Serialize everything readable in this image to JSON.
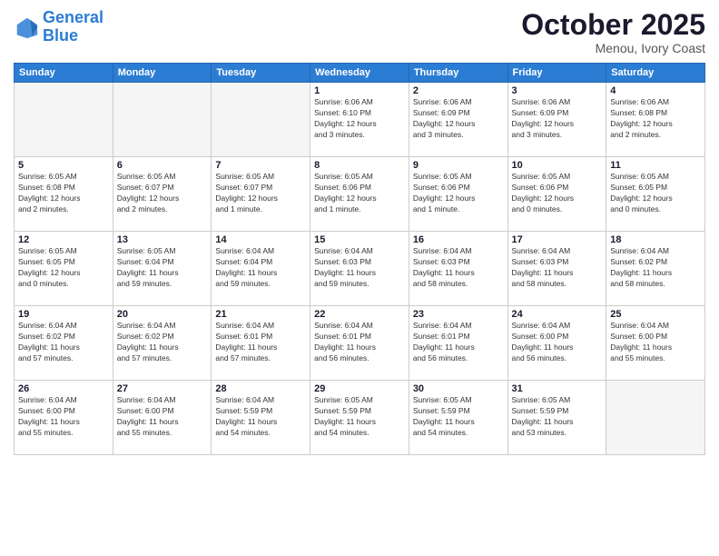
{
  "logo": {
    "line1": "General",
    "line2": "Blue"
  },
  "header": {
    "month": "October 2025",
    "location": "Menou, Ivory Coast"
  },
  "weekdays": [
    "Sunday",
    "Monday",
    "Tuesday",
    "Wednesday",
    "Thursday",
    "Friday",
    "Saturday"
  ],
  "weeks": [
    [
      {
        "day": "",
        "info": ""
      },
      {
        "day": "",
        "info": ""
      },
      {
        "day": "",
        "info": ""
      },
      {
        "day": "1",
        "info": "Sunrise: 6:06 AM\nSunset: 6:10 PM\nDaylight: 12 hours\nand 3 minutes."
      },
      {
        "day": "2",
        "info": "Sunrise: 6:06 AM\nSunset: 6:09 PM\nDaylight: 12 hours\nand 3 minutes."
      },
      {
        "day": "3",
        "info": "Sunrise: 6:06 AM\nSunset: 6:09 PM\nDaylight: 12 hours\nand 3 minutes."
      },
      {
        "day": "4",
        "info": "Sunrise: 6:06 AM\nSunset: 6:08 PM\nDaylight: 12 hours\nand 2 minutes."
      }
    ],
    [
      {
        "day": "5",
        "info": "Sunrise: 6:05 AM\nSunset: 6:08 PM\nDaylight: 12 hours\nand 2 minutes."
      },
      {
        "day": "6",
        "info": "Sunrise: 6:05 AM\nSunset: 6:07 PM\nDaylight: 12 hours\nand 2 minutes."
      },
      {
        "day": "7",
        "info": "Sunrise: 6:05 AM\nSunset: 6:07 PM\nDaylight: 12 hours\nand 1 minute."
      },
      {
        "day": "8",
        "info": "Sunrise: 6:05 AM\nSunset: 6:06 PM\nDaylight: 12 hours\nand 1 minute."
      },
      {
        "day": "9",
        "info": "Sunrise: 6:05 AM\nSunset: 6:06 PM\nDaylight: 12 hours\nand 1 minute."
      },
      {
        "day": "10",
        "info": "Sunrise: 6:05 AM\nSunset: 6:06 PM\nDaylight: 12 hours\nand 0 minutes."
      },
      {
        "day": "11",
        "info": "Sunrise: 6:05 AM\nSunset: 6:05 PM\nDaylight: 12 hours\nand 0 minutes."
      }
    ],
    [
      {
        "day": "12",
        "info": "Sunrise: 6:05 AM\nSunset: 6:05 PM\nDaylight: 12 hours\nand 0 minutes."
      },
      {
        "day": "13",
        "info": "Sunrise: 6:05 AM\nSunset: 6:04 PM\nDaylight: 11 hours\nand 59 minutes."
      },
      {
        "day": "14",
        "info": "Sunrise: 6:04 AM\nSunset: 6:04 PM\nDaylight: 11 hours\nand 59 minutes."
      },
      {
        "day": "15",
        "info": "Sunrise: 6:04 AM\nSunset: 6:03 PM\nDaylight: 11 hours\nand 59 minutes."
      },
      {
        "day": "16",
        "info": "Sunrise: 6:04 AM\nSunset: 6:03 PM\nDaylight: 11 hours\nand 58 minutes."
      },
      {
        "day": "17",
        "info": "Sunrise: 6:04 AM\nSunset: 6:03 PM\nDaylight: 11 hours\nand 58 minutes."
      },
      {
        "day": "18",
        "info": "Sunrise: 6:04 AM\nSunset: 6:02 PM\nDaylight: 11 hours\nand 58 minutes."
      }
    ],
    [
      {
        "day": "19",
        "info": "Sunrise: 6:04 AM\nSunset: 6:02 PM\nDaylight: 11 hours\nand 57 minutes."
      },
      {
        "day": "20",
        "info": "Sunrise: 6:04 AM\nSunset: 6:02 PM\nDaylight: 11 hours\nand 57 minutes."
      },
      {
        "day": "21",
        "info": "Sunrise: 6:04 AM\nSunset: 6:01 PM\nDaylight: 11 hours\nand 57 minutes."
      },
      {
        "day": "22",
        "info": "Sunrise: 6:04 AM\nSunset: 6:01 PM\nDaylight: 11 hours\nand 56 minutes."
      },
      {
        "day": "23",
        "info": "Sunrise: 6:04 AM\nSunset: 6:01 PM\nDaylight: 11 hours\nand 56 minutes."
      },
      {
        "day": "24",
        "info": "Sunrise: 6:04 AM\nSunset: 6:00 PM\nDaylight: 11 hours\nand 56 minutes."
      },
      {
        "day": "25",
        "info": "Sunrise: 6:04 AM\nSunset: 6:00 PM\nDaylight: 11 hours\nand 55 minutes."
      }
    ],
    [
      {
        "day": "26",
        "info": "Sunrise: 6:04 AM\nSunset: 6:00 PM\nDaylight: 11 hours\nand 55 minutes."
      },
      {
        "day": "27",
        "info": "Sunrise: 6:04 AM\nSunset: 6:00 PM\nDaylight: 11 hours\nand 55 minutes."
      },
      {
        "day": "28",
        "info": "Sunrise: 6:04 AM\nSunset: 5:59 PM\nDaylight: 11 hours\nand 54 minutes."
      },
      {
        "day": "29",
        "info": "Sunrise: 6:05 AM\nSunset: 5:59 PM\nDaylight: 11 hours\nand 54 minutes."
      },
      {
        "day": "30",
        "info": "Sunrise: 6:05 AM\nSunset: 5:59 PM\nDaylight: 11 hours\nand 54 minutes."
      },
      {
        "day": "31",
        "info": "Sunrise: 6:05 AM\nSunset: 5:59 PM\nDaylight: 11 hours\nand 53 minutes."
      },
      {
        "day": "",
        "info": ""
      }
    ]
  ]
}
